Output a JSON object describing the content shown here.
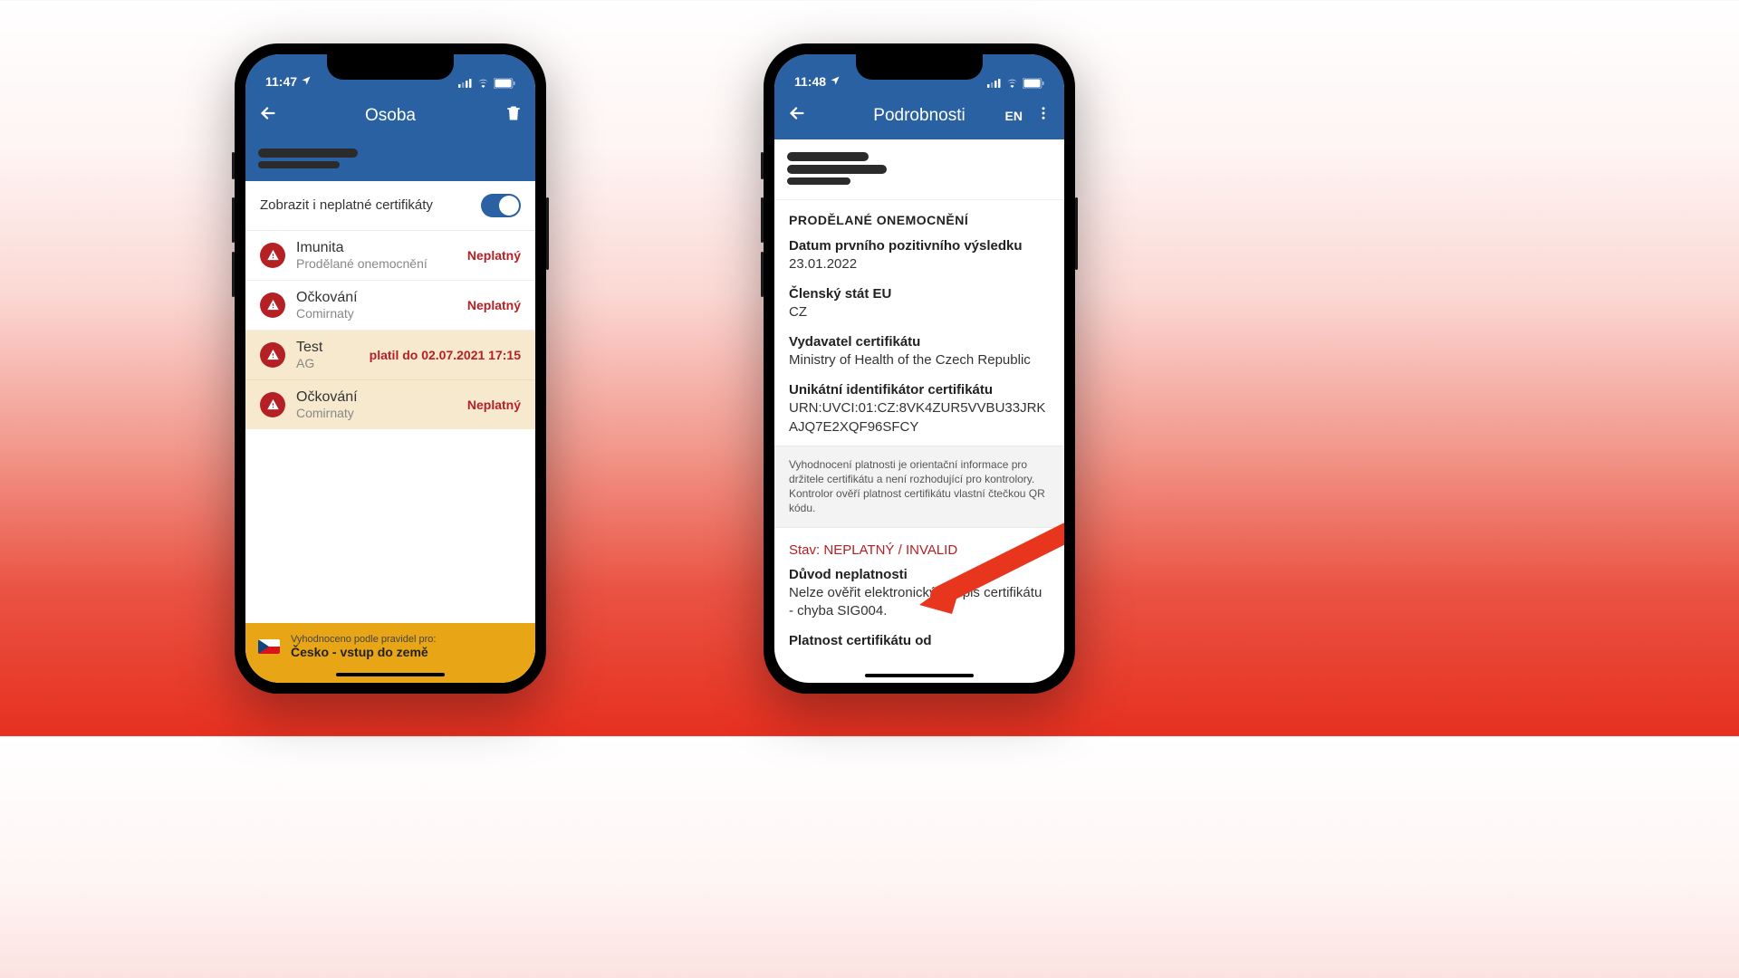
{
  "phone_left": {
    "status": {
      "time": "11:47",
      "location_icon": true
    },
    "header": {
      "title": "Osoba"
    },
    "toggle": {
      "label": "Zobrazit i neplatné certifikáty",
      "enabled": true
    },
    "certs": [
      {
        "title": "Imunita",
        "subtitle": "Prodělané onemocnění",
        "status": "Neplatný",
        "highlight": false
      },
      {
        "title": "Očkování",
        "subtitle": "Comirnaty",
        "status": "Neplatný",
        "highlight": false
      },
      {
        "title": "Test",
        "subtitle": "AG",
        "status": "platil do 02.07.2021 17:15",
        "highlight": true
      },
      {
        "title": "Očkování",
        "subtitle": "Comirnaty",
        "status": "Neplatný",
        "highlight": true
      }
    ],
    "footer": {
      "small": "Vyhodnoceno podle pravidel pro:",
      "big": "Česko - vstup do země"
    }
  },
  "phone_right": {
    "status": {
      "time": "11:48"
    },
    "header": {
      "title": "Podrobnosti",
      "lang": "EN"
    },
    "section_title": "PRODĚLANÉ ONEMOCNĚNÍ",
    "fields": {
      "first_positive_label": "Datum prvního pozitivního výsledku",
      "first_positive_value": "23.01.2022",
      "state_label": "Členský stát EU",
      "state_value": "CZ",
      "issuer_label": "Vydavatel certifikátu",
      "issuer_value": "Ministry of Health of the Czech Republic",
      "uid_label": "Unikátní identifikátor certifikátu",
      "uid_value": "URN:UVCI:01:CZ:8VK4ZUR5VVBU33JRKAJQ7E2XQF96SFCY"
    },
    "info_note": "Vyhodnocení platnosti je orientační informace pro držitele certifikátu a není rozhodující pro kontrolory. Kontrolor ověří platnost certifikátu vlastní čtečkou QR kódu.",
    "status_prefix": "Stav:  ",
    "status_value": "NEPLATNÝ / INVALID",
    "reason_label": "Důvod neplatnosti",
    "reason_value": "Nelze ověřit elektronický podpis certifikátu - chyba SIG004.",
    "validity_from_label": "Platnost certifikátu od"
  }
}
